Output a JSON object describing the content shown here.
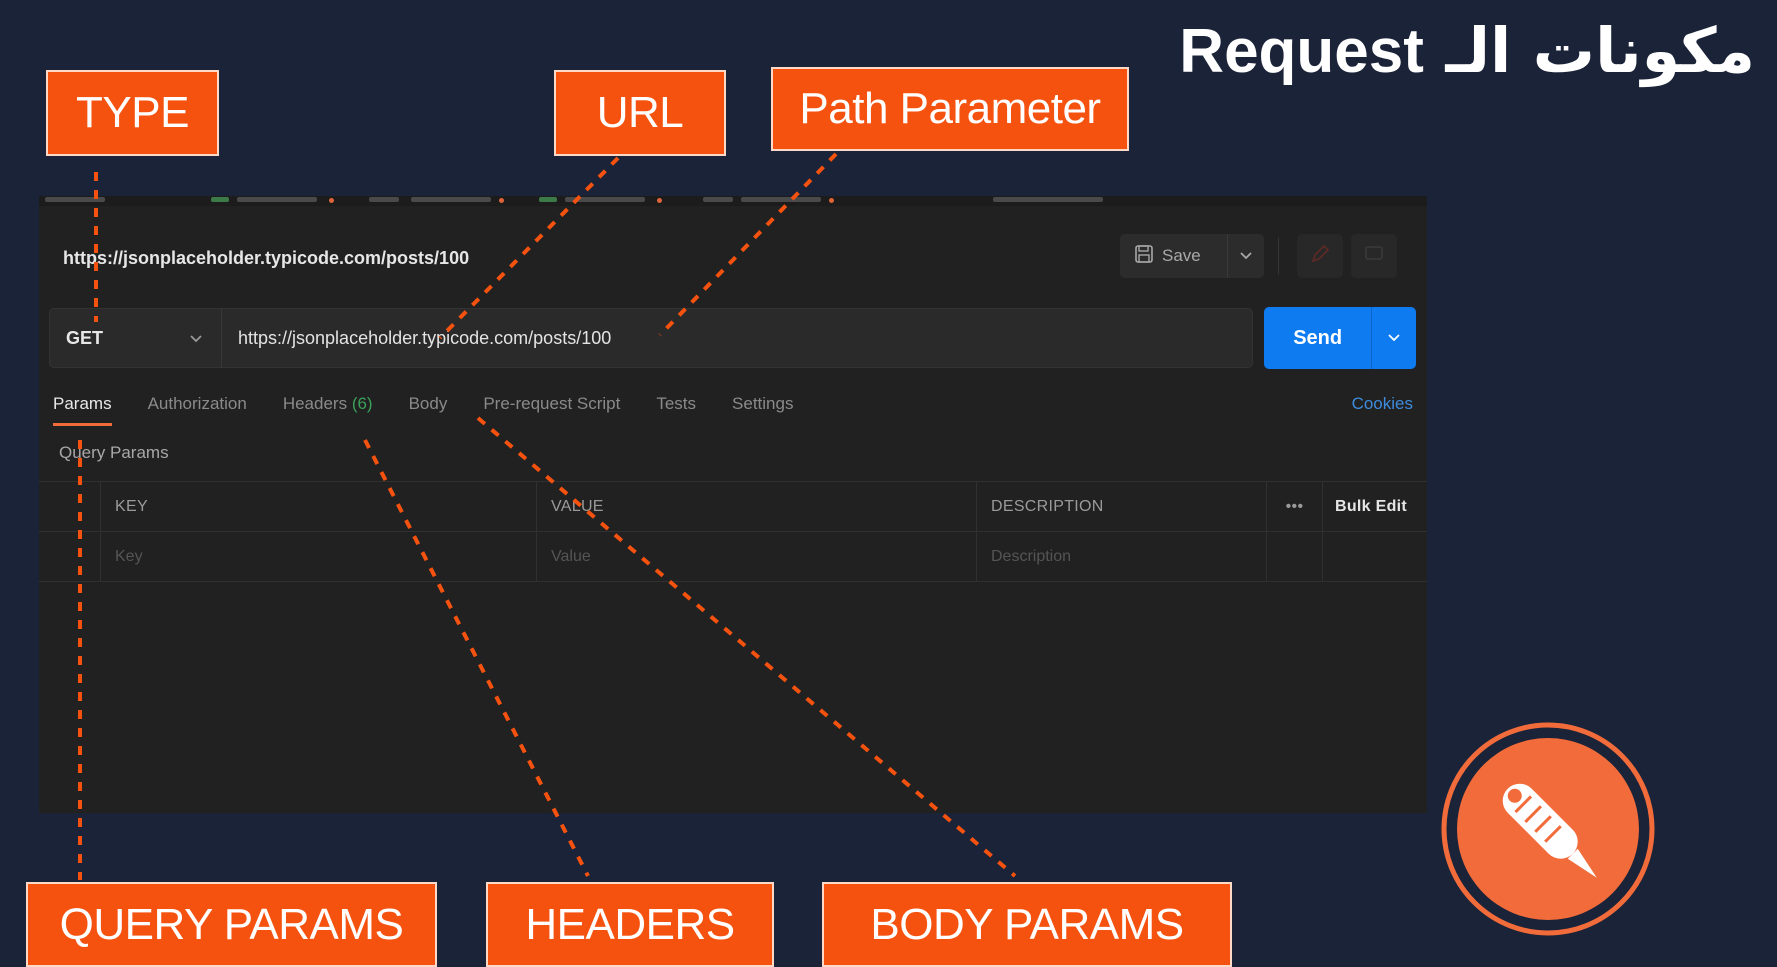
{
  "slide": {
    "title_arabic": "مكونات الـ",
    "title_latin": "Request",
    "labels": {
      "type": "TYPE",
      "url": "URL",
      "path_parameter": "Path Parameter",
      "query_params": "QUERY PARAMS",
      "headers": "HEADERS",
      "body_params": "BODY PARAMS"
    },
    "colors": {
      "background": "#1b2338",
      "callout": "#f5520f",
      "dashed_line": "#f5520f"
    }
  },
  "postman": {
    "request_name": "https://jsonplaceholder.typicode.com/posts/100",
    "save_label": "Save",
    "method": "GET",
    "url": "https://jsonplaceholder.typicode.com/posts/100",
    "send_label": "Send",
    "tabs": [
      {
        "label": "Params",
        "active": true
      },
      {
        "label": "Authorization"
      },
      {
        "label": "Headers",
        "count": "(6)"
      },
      {
        "label": "Body"
      },
      {
        "label": "Pre-request Script"
      },
      {
        "label": "Tests"
      },
      {
        "label": "Settings"
      }
    ],
    "cookies_label": "Cookies",
    "query_params_label": "Query Params",
    "table": {
      "headers": [
        "KEY",
        "VALUE",
        "DESCRIPTION"
      ],
      "more_label": "•••",
      "bulk_edit_label": "Bulk Edit",
      "placeholders": [
        "Key",
        "Value",
        "Description"
      ]
    },
    "colors": {
      "send_button": "#0f7bf0",
      "active_tab_underline": "#f26b3a",
      "headers_count": "#3aa05a",
      "cookies_link": "#3d8bdc"
    }
  },
  "logo": {
    "icon": "postman-logo-icon",
    "color": "#f26b3a"
  }
}
